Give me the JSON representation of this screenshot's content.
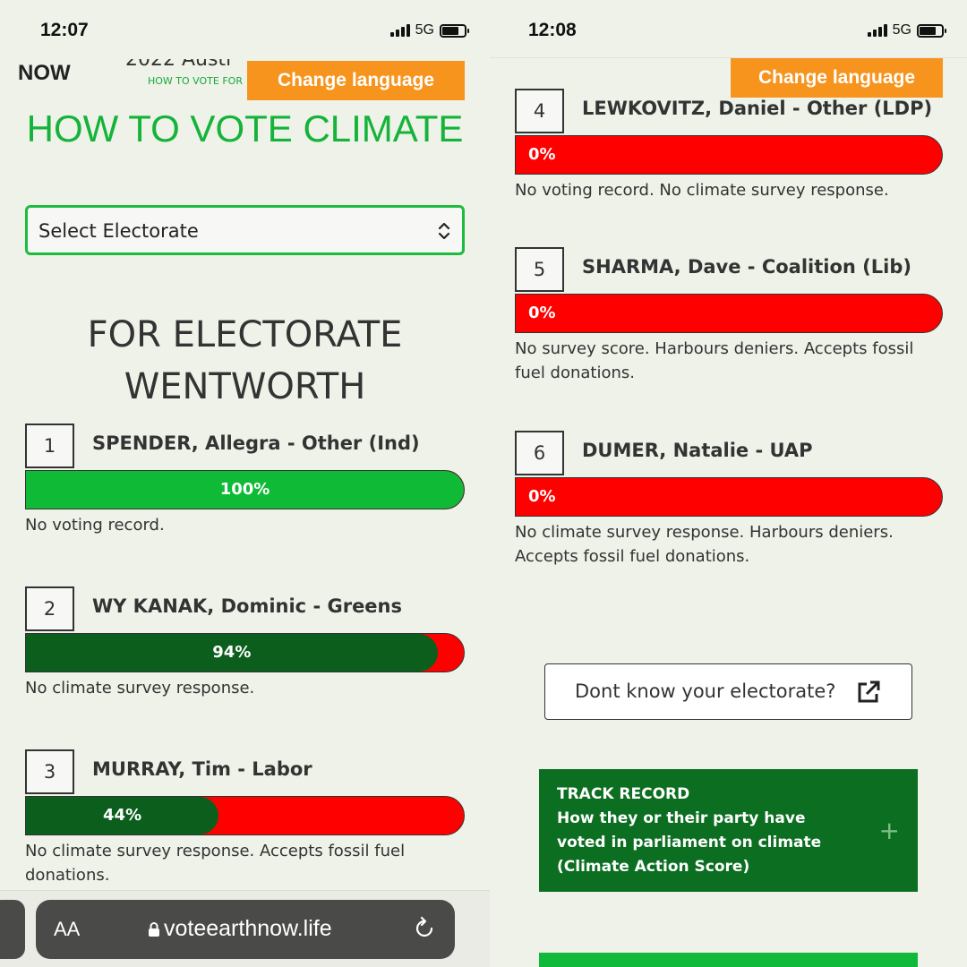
{
  "left": {
    "status": {
      "time": "12:07",
      "network": "5G"
    },
    "header": {
      "logo": "NOW",
      "subtitle": "2022 Austr",
      "sublink": "HOW TO VOTE FOR"
    },
    "change_language": "Change language",
    "title": "HOW TO VOTE CLIMATE",
    "select": {
      "label": "Select Electorate"
    },
    "electorate_title_line1": "FOR ELECTORATE",
    "electorate_title_line2": "WENTWORTH",
    "candidates": [
      {
        "num": "1",
        "name": "SPENDER, Allegra - Other (Ind)",
        "pct_label": "100%",
        "score": 100,
        "note": "No voting record."
      },
      {
        "num": "2",
        "name": "WY KANAK, Dominic - Greens",
        "pct_label": "94%",
        "score": 94,
        "note": "No climate survey response."
      },
      {
        "num": "3",
        "name": "MURRAY, Tim - Labor",
        "pct_label": "44%",
        "score": 44,
        "note": "No climate survey response. Accepts fossil fuel donations."
      }
    ],
    "browser": {
      "aa": "AA",
      "url": "voteearthnow.life"
    }
  },
  "right": {
    "status": {
      "time": "12:08",
      "network": "5G"
    },
    "change_language": "Change language",
    "candidates": [
      {
        "num": "4",
        "name": "LEWKOVITZ, Daniel - Other (LDP)",
        "pct_label": "0%",
        "score": 0,
        "note": "No voting record. No climate survey response."
      },
      {
        "num": "5",
        "name": "SHARMA, Dave - Coalition (Lib)",
        "pct_label": "0%",
        "score": 0,
        "note": "No survey score. Harbours deniers. Accepts fossil fuel donations."
      },
      {
        "num": "6",
        "name": "DUMER, Natalie - UAP",
        "pct_label": "0%",
        "score": 0,
        "note": "No climate survey response. Harbours deniers. Accepts fossil fuel donations."
      }
    ],
    "dont_know": "Dont know your electorate?",
    "track": {
      "heading": "TRACK RECORD",
      "body": "How they or their party have voted in parliament on climate (Climate Action Score)",
      "expand": "+"
    }
  },
  "colors": {
    "green_bright": "#0fba36",
    "green_dark": "#0b5e1c",
    "red": "#ff0000",
    "orange": "#f7941d"
  }
}
